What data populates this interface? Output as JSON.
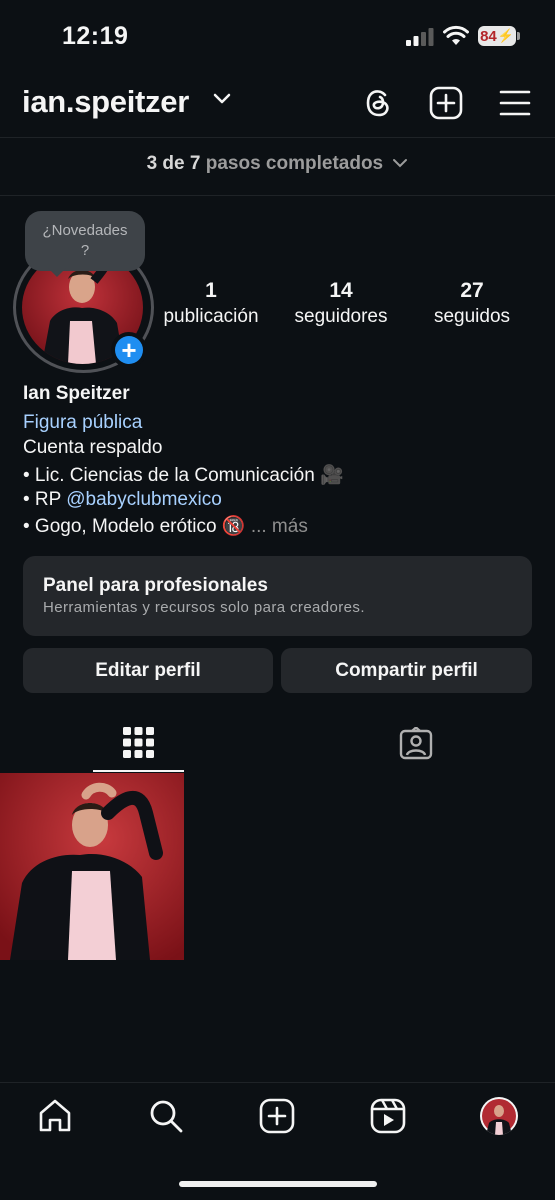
{
  "status_bar": {
    "time": "12:19",
    "battery": "84"
  },
  "header": {
    "username": "ian.speitzer"
  },
  "progress": {
    "count": "3 de 7",
    "label": "pasos completados"
  },
  "tooltip": {
    "line1": "¿Novedades",
    "line2": "?"
  },
  "stats": [
    {
      "value": "1",
      "label": "publicación"
    },
    {
      "value": "14",
      "label": "seguidores"
    },
    {
      "value": "27",
      "label": "seguidos"
    }
  ],
  "profile": {
    "name": "Ian Speitzer",
    "category": "Figura pública",
    "bio_line1": "Cuenta respaldo",
    "bio_line2": "• Lic. Ciencias de la Comunicación 🎥",
    "bio_line3_prefix": "• RP ",
    "bio_line3_mention": "@babyclubmexico",
    "bio_line4": "• Gogo, Modelo erótico 🔞",
    "more": "... más"
  },
  "pro_panel": {
    "title": "Panel para profesionales",
    "subtitle": "Herramientas y recursos solo para creadores."
  },
  "actions": {
    "edit": "Editar perfil",
    "share": "Compartir perfil"
  },
  "icons": {
    "header": [
      "threads-icon",
      "new-post-icon",
      "menu-icon"
    ],
    "tabs": [
      "grid-icon",
      "tagged-icon"
    ],
    "nav": [
      "home-icon",
      "search-icon",
      "create-icon",
      "reels-icon",
      "profile-avatar-icon"
    ]
  },
  "colors": {
    "background": "#0c1014",
    "link": "#a8d1ff",
    "accent": "#1f8ef1",
    "surface": "#24272b"
  }
}
